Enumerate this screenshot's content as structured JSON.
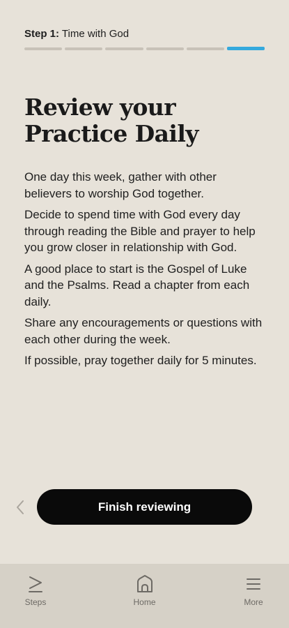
{
  "header": {
    "step_number": "Step 1:",
    "step_title": "Time with God",
    "progress": {
      "total_segments": 6,
      "active_segment": 6
    }
  },
  "main": {
    "title": "Review your Practice Daily",
    "paragraphs": [
      "One day this week, gather with other believers to worship God together.",
      "Decide to spend time with God every day through reading the Bible and prayer to help you grow closer in relationship with God.",
      "A good place to start is the Gospel of Luke and the Psalms. Read a chapter from each daily.",
      "Share any encouragements or questions with each other during the week.",
      "If possible, pray together daily for 5 minutes."
    ]
  },
  "actions": {
    "back_icon": "chevron-left-icon",
    "finish_label": "Finish reviewing"
  },
  "nav": {
    "items": [
      {
        "label": "Steps",
        "icon": "steps-icon"
      },
      {
        "label": "Home",
        "icon": "home-icon"
      },
      {
        "label": "More",
        "icon": "menu-icon"
      }
    ]
  },
  "colors": {
    "background": "#e7e2d9",
    "accent": "#35a9dd",
    "button": "#0a0a0a",
    "nav_background": "#d6d1c7"
  }
}
